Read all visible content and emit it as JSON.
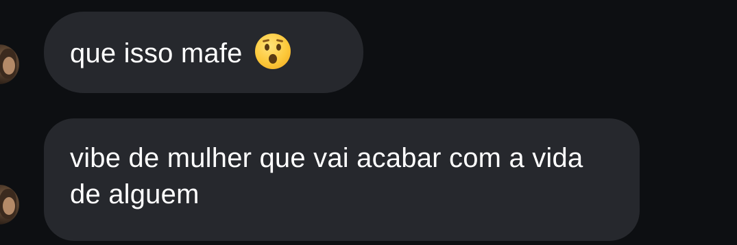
{
  "messages": [
    {
      "text": "que isso mafe",
      "emoji": "hushed-face-emoji"
    },
    {
      "text": "vibe de mulher que vai acabar com a vida de alguem"
    }
  ],
  "colors": {
    "background": "#0d0f12",
    "bubble": "#26282d",
    "text": "#ffffff"
  }
}
